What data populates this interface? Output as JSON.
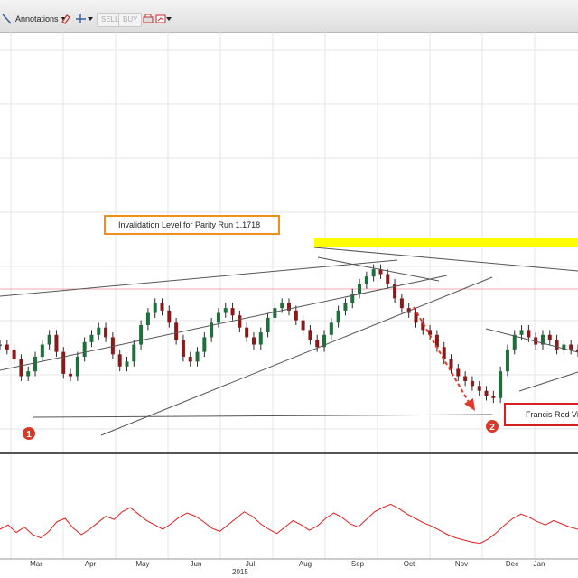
{
  "toolbar": {
    "annotations_label": "Annotations",
    "sell_label": "SELL",
    "buy_label": "BUY",
    "icons": [
      "line-tool-icon",
      "dropdown-arrow-icon",
      "eraser-icon",
      "crosshair-icon",
      "print-icon",
      "chart-settings-icon"
    ]
  },
  "callouts": {
    "invalidation": "Invalidation Level for Parity Run 1.1718",
    "francis": "Francis Red Vie"
  },
  "markers": {
    "one": "1",
    "two": "2"
  },
  "colors": {
    "candle": "#2a2a2a",
    "trend_line": "#555555",
    "yellow_band": "#ffff00",
    "red_level": "#f4a8a8",
    "oscillator": "#e02020",
    "callout_border": "#f0901a",
    "francis_border": "#d82020",
    "marker": "#d83a2a",
    "red_arrow": "#e03a2a"
  },
  "chart_data": {
    "type": "candlestick",
    "x_month_ticks": [
      "Mar",
      "Apr",
      "May",
      "Jun",
      "Jul",
      "Aug",
      "Sep",
      "Oct",
      "Nov",
      "Dec",
      "Jan"
    ],
    "year_label": "2015",
    "price_path": [
      62,
      58,
      50,
      36,
      40,
      52,
      62,
      70,
      56,
      38,
      36,
      52,
      64,
      70,
      76,
      68,
      54,
      44,
      48,
      62,
      78,
      88,
      96,
      90,
      80,
      66,
      52,
      48,
      56,
      68,
      80,
      88,
      92,
      86,
      76,
      68,
      62,
      72,
      84,
      92,
      96,
      90,
      82,
      74,
      66,
      60,
      70,
      80,
      90,
      96,
      104,
      112,
      118,
      124,
      120,
      112,
      100,
      92,
      88,
      80,
      74,
      70,
      60,
      50,
      42,
      36,
      32,
      28,
      24,
      20,
      18,
      40,
      58,
      70,
      74,
      68,
      62,
      70,
      66,
      58,
      62,
      58,
      56
    ],
    "oscillator_path": [
      40,
      48,
      34,
      44,
      30,
      24,
      36,
      54,
      60,
      42,
      30,
      40,
      52,
      64,
      58,
      72,
      80,
      68,
      56,
      48,
      40,
      50,
      62,
      70,
      64,
      54,
      42,
      36,
      48,
      60,
      72,
      64,
      50,
      40,
      32,
      44,
      56,
      48,
      38,
      46,
      60,
      70,
      62,
      50,
      44,
      58,
      72,
      80,
      86,
      78,
      68,
      60,
      52,
      46,
      38,
      30,
      24,
      20,
      16,
      14,
      22,
      34,
      48,
      60,
      68,
      62,
      54,
      48,
      56,
      50,
      44,
      40
    ]
  }
}
